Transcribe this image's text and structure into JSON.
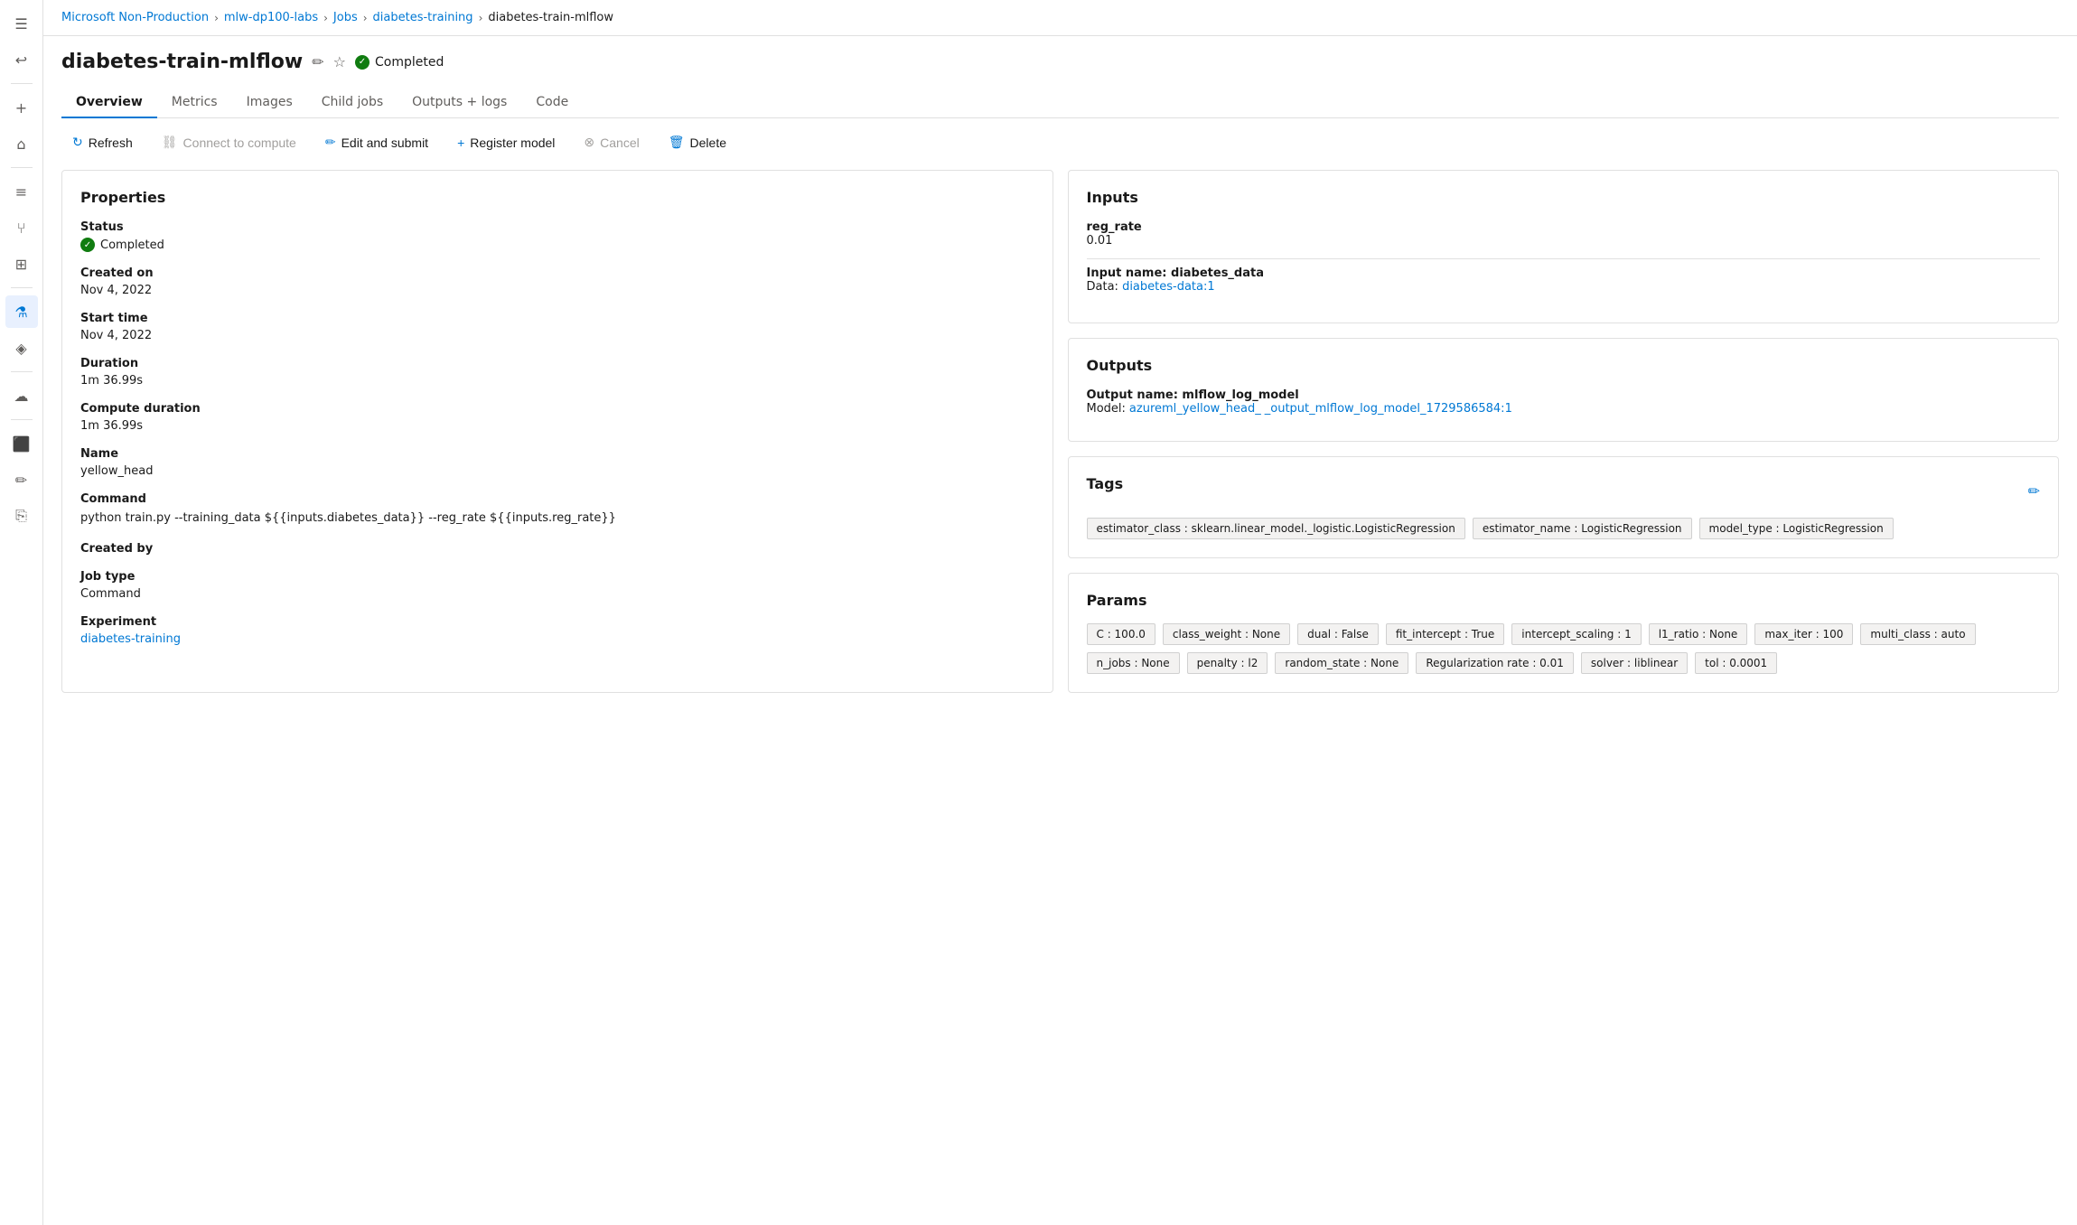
{
  "breadcrumb": {
    "items": [
      {
        "label": "Microsoft Non-Production",
        "link": true
      },
      {
        "label": "mlw-dp100-labs",
        "link": true
      },
      {
        "label": "Jobs",
        "link": true
      },
      {
        "label": "diabetes-training",
        "link": true
      },
      {
        "label": "diabetes-train-mlflow",
        "link": false
      }
    ],
    "separators": [
      ">",
      ">",
      ">",
      ">"
    ]
  },
  "page": {
    "title": "diabetes-train-mlflow",
    "status": "Completed"
  },
  "tabs": [
    {
      "label": "Overview",
      "active": true
    },
    {
      "label": "Metrics",
      "active": false
    },
    {
      "label": "Images",
      "active": false
    },
    {
      "label": "Child jobs",
      "active": false
    },
    {
      "label": "Outputs + logs",
      "active": false
    },
    {
      "label": "Code",
      "active": false
    }
  ],
  "toolbar": {
    "refresh_label": "Refresh",
    "connect_label": "Connect to compute",
    "edit_label": "Edit and submit",
    "register_label": "Register model",
    "cancel_label": "Cancel",
    "delete_label": "Delete"
  },
  "properties": {
    "title": "Properties",
    "fields": [
      {
        "label": "Status",
        "value": "Completed",
        "type": "status"
      },
      {
        "label": "Created on",
        "value": "Nov 4, 2022",
        "type": "text"
      },
      {
        "label": "Start time",
        "value": "Nov 4, 2022",
        "type": "text"
      },
      {
        "label": "Duration",
        "value": "1m 36.99s",
        "type": "text"
      },
      {
        "label": "Compute duration",
        "value": "1m 36.99s",
        "type": "text"
      },
      {
        "label": "Name",
        "value": "yellow_head",
        "type": "text"
      },
      {
        "label": "Command",
        "value": "python train.py --training_data ${{inputs.diabetes_data}} --reg_rate ${{inputs.reg_rate}}",
        "type": "command"
      },
      {
        "label": "Created by",
        "value": "",
        "type": "text"
      },
      {
        "label": "Job type",
        "value": "Command",
        "type": "text"
      },
      {
        "label": "Experiment",
        "value": "diabetes-training",
        "type": "link"
      }
    ]
  },
  "inputs": {
    "title": "Inputs",
    "reg_rate_label": "reg_rate",
    "reg_rate_value": "0.01",
    "input_name_label": "Input name: diabetes_data",
    "data_label": "Data:",
    "data_link": "diabetes-data:1"
  },
  "outputs": {
    "title": "Outputs",
    "output_name_label": "Output name: mlflow_log_model",
    "model_label": "Model:",
    "model_link_1": "azureml_yellow_head_",
    "model_link_2": "_output_mlflow_log_model_1729586584:1"
  },
  "tags": {
    "title": "Tags",
    "items": [
      "estimator_class : sklearn.linear_model._logistic.LogisticRegression",
      "estimator_name : LogisticRegression",
      "model_type : LogisticRegression"
    ]
  },
  "params": {
    "title": "Params",
    "items": [
      "C : 100.0",
      "class_weight : None",
      "dual : False",
      "fit_intercept : True",
      "intercept_scaling : 1",
      "l1_ratio : None",
      "max_iter : 100",
      "multi_class : auto",
      "n_jobs : None",
      "penalty : l2",
      "random_state : None",
      "Regularization rate : 0.01",
      "solver : liblinear",
      "tol : 0.0001"
    ]
  },
  "sidebar": {
    "icons": [
      {
        "name": "menu-icon",
        "symbol": "☰"
      },
      {
        "name": "back-icon",
        "symbol": "↩"
      },
      {
        "name": "create-icon",
        "symbol": "+"
      },
      {
        "name": "home-icon",
        "symbol": "⌂"
      },
      {
        "name": "jobs-icon",
        "symbol": "☰"
      },
      {
        "name": "pipeline-icon",
        "symbol": "⑂"
      },
      {
        "name": "cluster-icon",
        "symbol": "⊞"
      },
      {
        "name": "compute-icon",
        "symbol": "▣"
      },
      {
        "name": "experiment-icon",
        "symbol": "⚗"
      },
      {
        "name": "deploy-icon",
        "symbol": "◈"
      },
      {
        "name": "cloud-icon",
        "symbol": "☁"
      },
      {
        "name": "monitor-icon",
        "symbol": "⬛"
      },
      {
        "name": "edit-icon",
        "symbol": "✏"
      },
      {
        "name": "output-icon",
        "symbol": "⎘"
      }
    ]
  }
}
